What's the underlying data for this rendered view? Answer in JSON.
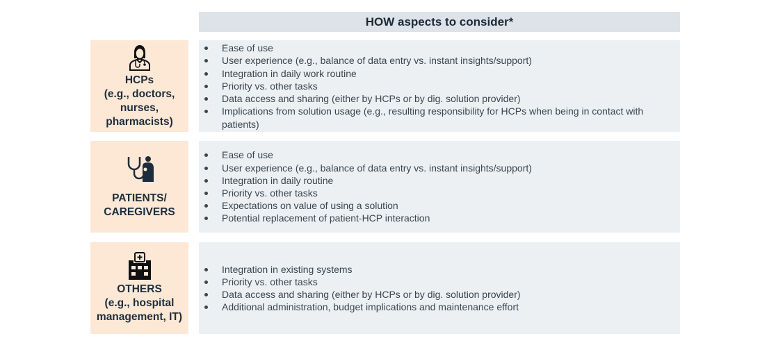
{
  "header": {
    "title": "HOW aspects to consider*"
  },
  "rows": [
    {
      "icon": "doctor-icon",
      "label": "HCPs\n(e.g., doctors,\nnurses,\npharmacists)",
      "label_lines": [
        "HCPs",
        "(e.g., doctors,",
        "nurses,",
        "pharmacists)"
      ],
      "items": [
        "Ease of use",
        "User experience (e.g., balance of data entry vs. instant insights/support)",
        "Integration in daily work routine",
        "Priority vs. other tasks",
        "Data access and sharing (either by HCPs or by dig. solution provider)",
        "Implications from solution usage (e.g., resulting responsibility for HCPs when being in contact with patients)"
      ]
    },
    {
      "icon": "stethoscope-patient-icon",
      "label_lines": [
        "PATIENTS/",
        "CAREGIVERS"
      ],
      "items": [
        "Ease of use",
        "User experience (e.g., balance of data entry vs. instant insights/support)",
        "Integration in daily routine",
        "Priority vs. other tasks",
        "Expectations on value of using a solution",
        "Potential replacement of patient-HCP interaction"
      ]
    },
    {
      "icon": "hospital-icon",
      "label_lines": [
        "OTHERS",
        "(e.g., hospital",
        "management, IT)"
      ],
      "items": [
        "Integration in existing systems",
        "Priority vs. other tasks",
        "Data access and sharing (either by HCPs or by dig. solution provider)",
        "Additional administration, budget implications and maintenance effort"
      ]
    }
  ],
  "colors": {
    "header_bg": "#dde3e8",
    "label_bg": "#fce8d5",
    "content_bg": "#edf0f3",
    "text_dark": "#1e2d3d"
  }
}
